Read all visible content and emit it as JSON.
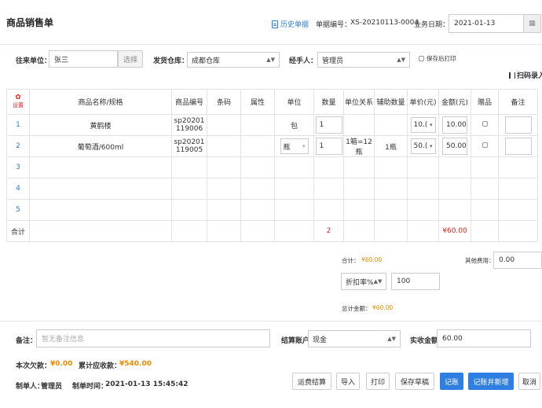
{
  "header": {
    "title": "商品销售单",
    "history_link": "历史单据",
    "doc_no_label": "单据编号：",
    "doc_no": "XS-20210113-0004",
    "date_label": "业务日期：",
    "date_value": "2021-01-13"
  },
  "form": {
    "partner_label": "往来单位：",
    "partner_value": "张三",
    "partner_btn": "选择",
    "warehouse_label": "发货仓库：",
    "warehouse_value": "成都仓库",
    "handler_label": "经手人：",
    "handler_value": "管理员",
    "print_after_save": "保存后打印",
    "scan_entry": "扫码录入"
  },
  "table": {
    "settings_label": "设置",
    "columns": [
      "商品名称/规格",
      "商品编号",
      "条码",
      "属性",
      "单位",
      "数量",
      "单位关系",
      "辅助数量",
      "单价(元)",
      "金额(元)",
      "赠品",
      "备注"
    ],
    "rows": [
      {
        "num": "1",
        "name": "黄鹤楼",
        "code_1": "sp20201",
        "code_2": "119006",
        "unit": "包",
        "qty": "1",
        "relation": "",
        "aux_qty": "",
        "price": "10.(",
        "amount": "10.00"
      },
      {
        "num": "2",
        "name": "葡萄酒/600ml",
        "code_1": "sp20201",
        "code_2": "119005",
        "unit": "瓶",
        "qty": "1",
        "relation_1": "1箱=12",
        "relation_2": "瓶",
        "aux_qty": "1瓶",
        "price": "50.(",
        "amount": "50.00"
      }
    ],
    "empty_rows": [
      "3",
      "4",
      "5"
    ],
    "total_label": "合计",
    "total_qty": "2",
    "total_amount": "¥60.00"
  },
  "summary": {
    "subtotal_label": "合计：",
    "subtotal_value": "¥60.00",
    "other_fee_label": "其他费用：",
    "other_fee_value": "0.00",
    "discount_select": "折扣率%",
    "discount_value": "100",
    "grand_total_label": "总计金额：",
    "grand_total_value": "¥60.00"
  },
  "footer": {
    "remark_label": "备注：",
    "remark_placeholder": "暂无备注信息",
    "account_label": "结算账户",
    "account_value": "现金",
    "received_label": "实收金额",
    "received_value": "60.00",
    "debt_label": "本次欠款：",
    "debt_value": "¥0.00",
    "receivable_label": "累计应收款：",
    "receivable_value": "¥540.00",
    "maker_label": "制单人：",
    "maker_value": "管理员",
    "time_label": "制单时间：",
    "time_value": "2021-01-13 15:45:42"
  },
  "buttons": {
    "freight": "运费结算",
    "import": "导入",
    "print": "打印",
    "draft": "保存草稿",
    "post": "记账",
    "post_new": "记账并新增",
    "cancel": "取消"
  },
  "colors": {
    "primary": "#2f7fe3",
    "orange": "#f08a00",
    "red": "#e02020",
    "link": "#2a7fd4"
  }
}
